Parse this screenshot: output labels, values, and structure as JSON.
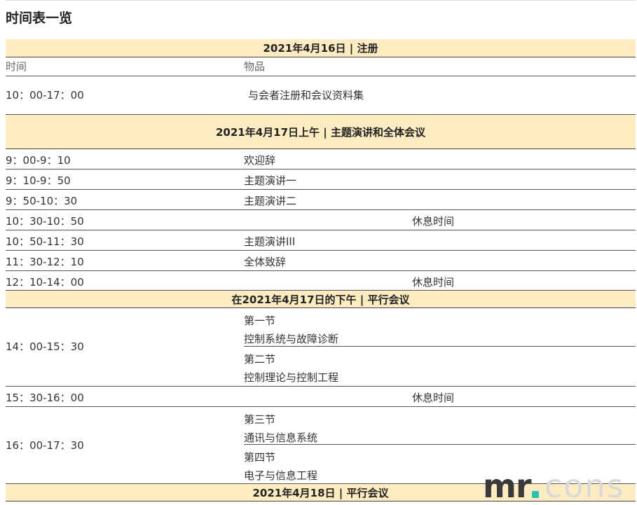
{
  "page": {
    "title": "时间表一览"
  },
  "schedule": {
    "day1": {
      "header": "2021年4月16日 | 注册",
      "col_time": "时间",
      "col_item": "物品",
      "row1": {
        "time": "10：00-17：00",
        "item": "与会者注册和会议资料集"
      }
    },
    "day2am": {
      "header": "2021年4月17日上午 | 主题演讲和全体会议",
      "rows": [
        {
          "time": "9：00-9：10",
          "item": "欢迎辞"
        },
        {
          "time": "9：10-9：50",
          "item": "主题演讲一"
        },
        {
          "time": "9：50-10：30",
          "item": "主题演讲二"
        },
        {
          "time": "10：30-10：50",
          "break": "休息时间"
        },
        {
          "time": "10：50-11：30",
          "item": "主题演讲III"
        },
        {
          "time": "11：30-12：10",
          "item": "全体致辞"
        },
        {
          "time": "12：10-14：00",
          "break": "休息时间"
        }
      ]
    },
    "day2pm": {
      "header": "在2021年4月17日的下午 | 平行会议",
      "block1": {
        "time": "14：00-15：30",
        "s1": {
          "name": "第一节",
          "topic": "控制系统与故障诊断"
        },
        "s2": {
          "name": "第二节",
          "topic": "控制理论与控制工程"
        }
      },
      "break": {
        "time": "15：30-16：00",
        "label": "休息时间"
      },
      "block2": {
        "time": "16：00-17：30",
        "s3": {
          "name": "第三节",
          "topic": "通讯与信息系统"
        },
        "s4": {
          "name": "第四节",
          "topic": "电子与信息工程"
        }
      }
    },
    "day3": {
      "header": "2021年4月18日 | 平行会议"
    }
  },
  "watermark": {
    "left": "mr",
    "right": "cons",
    "accent": "#2ac1b3"
  }
}
